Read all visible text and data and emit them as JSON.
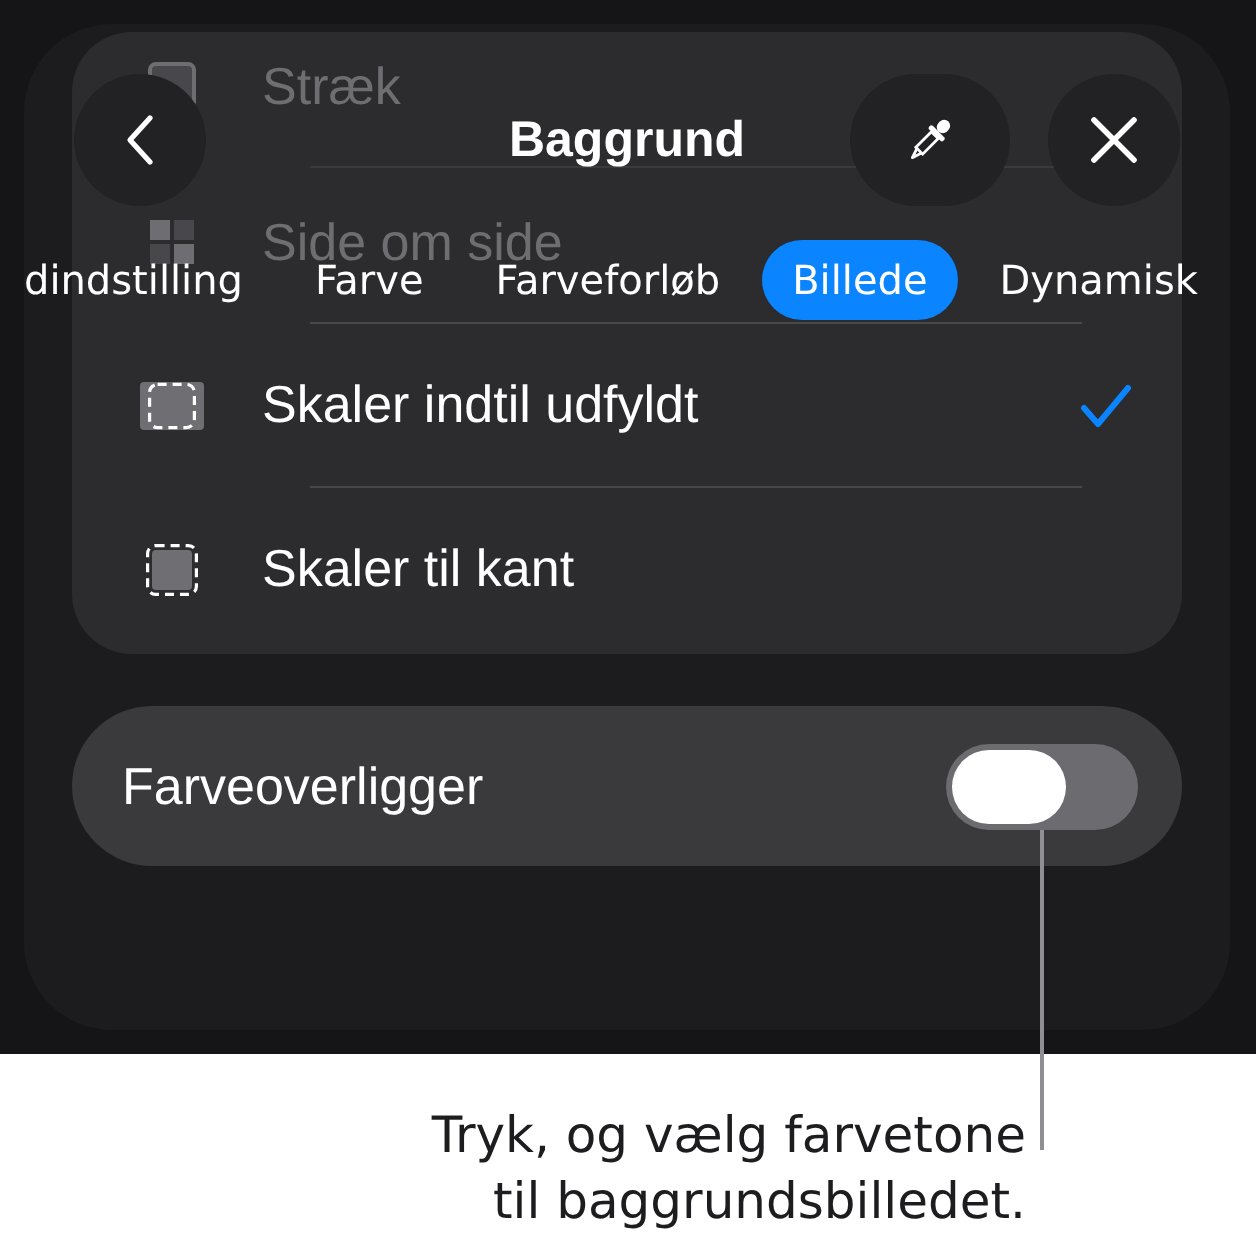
{
  "header": {
    "title": "Baggrund"
  },
  "background_options": [
    {
      "kind": "stretch",
      "label": "Stræk"
    },
    {
      "kind": "tile",
      "label": "Side om side"
    }
  ],
  "tabs": [
    {
      "label": "dindstilling",
      "selected": false
    },
    {
      "label": "Farve",
      "selected": false
    },
    {
      "label": "Farveforløb",
      "selected": false
    },
    {
      "label": "Billede",
      "selected": true
    },
    {
      "label": "Dynamisk",
      "selected": false
    }
  ],
  "scale_options": [
    {
      "kind": "fill",
      "label": "Skaler indtil udfyldt",
      "selected": true
    },
    {
      "kind": "fit",
      "label": "Skaler til kant",
      "selected": false
    }
  ],
  "color_overlay": {
    "label": "Farveoverligger",
    "on": false
  },
  "callout": {
    "text": "Tryk, og vælg farvetone\ntil baggrundsbilledet."
  }
}
